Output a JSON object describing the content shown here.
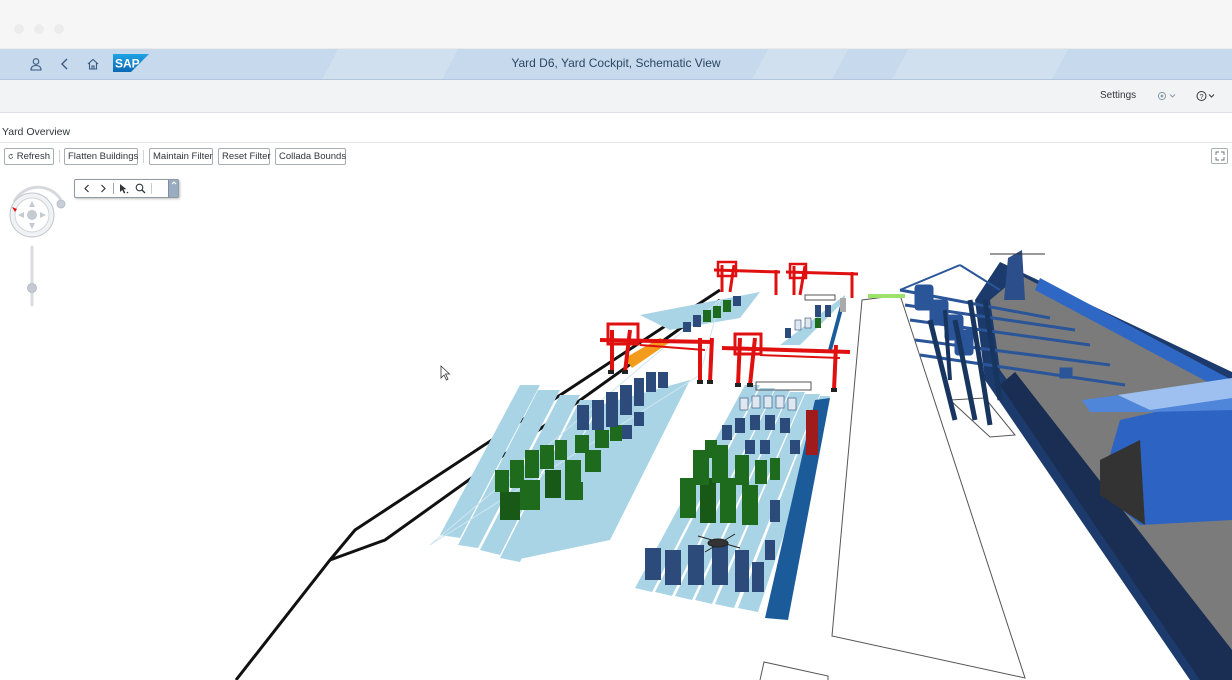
{
  "shell": {
    "title": "Yard D6, Yard Cockpit, Schematic View",
    "logo_text": "SAP",
    "icons": [
      "user-icon",
      "back-icon",
      "home-icon"
    ]
  },
  "header": {
    "settings_label": "Settings",
    "icons": [
      "settings-status-icon",
      "help-icon"
    ]
  },
  "page": {
    "title": "Yard Overview"
  },
  "toolbar": {
    "refresh": "Refresh",
    "flatten_buildings": "Flatten Buildings",
    "maintain_filter": "Maintain Filter",
    "reset_filter": "Reset Filter",
    "collada_bounds": "Collada Bounds",
    "icons": [
      "refresh-icon",
      "fullscreen-icon"
    ]
  },
  "viewer": {
    "nav_toolbar_icons": [
      "previous-icon",
      "next-icon",
      "select-pointer-icon",
      "zoom-icon"
    ],
    "scene": "3D container yard with gantry cranes, container blocks and docked ship"
  },
  "colors": {
    "shell_bg": "#c7d9ec",
    "crane_red": "#e01010",
    "container_green": "#1e6b1e",
    "container_blue": "#2d4b7a",
    "slot_lightblue": "#a9d4e6",
    "ship_hull": "#1f3f73",
    "ship_deck": "#7a7a7a"
  }
}
